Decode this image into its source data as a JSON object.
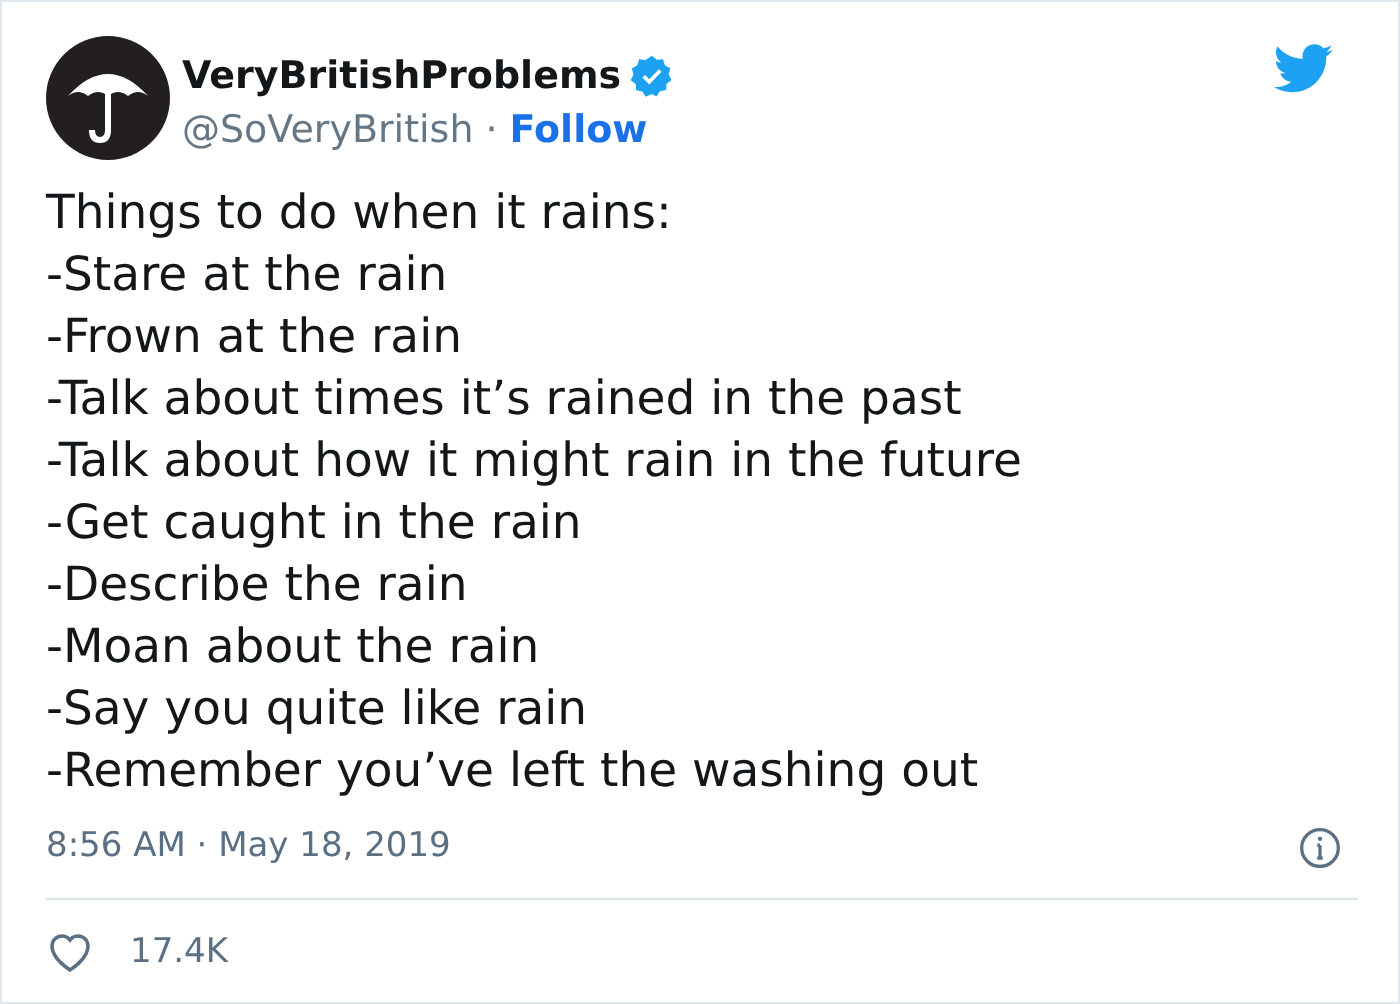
{
  "author": {
    "name": "VeryBritishProblems",
    "verified": true,
    "handle": "@SoVeryBritish",
    "separator": "·",
    "follow": "Follow"
  },
  "text_lines": [
    "Things to do when it rains:",
    "-Stare at the rain",
    "-Frown at the rain",
    "-Talk about times it’s rained in the past",
    "-Talk about how it might rain in the future",
    "-Get caught in the rain",
    "-Describe the rain",
    "-Moan about the rain",
    "-Say you quite like rain",
    "-Remember you’ve left the washing out"
  ],
  "timestamp": "8:56 AM · May 18, 2019",
  "likes": {
    "count": "17.4K",
    "liked": false
  }
}
